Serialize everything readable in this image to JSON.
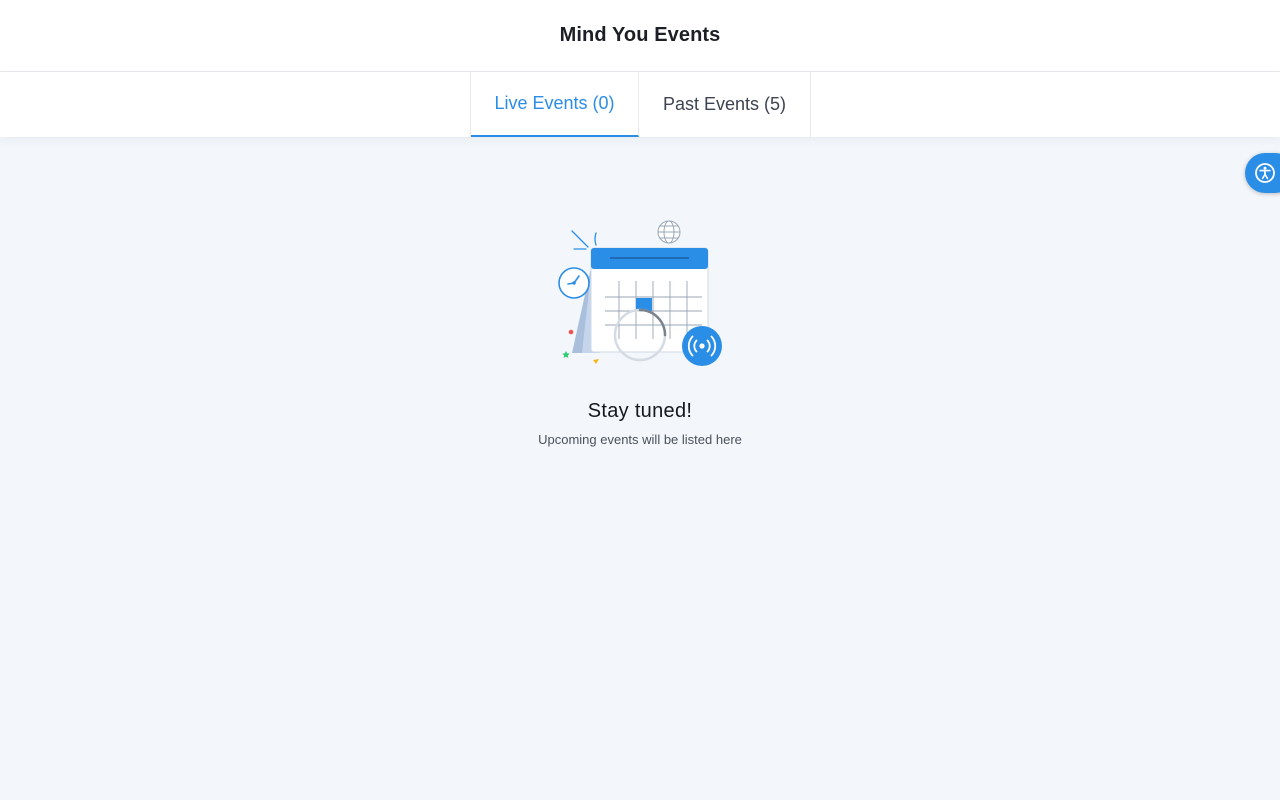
{
  "header": {
    "title": "Mind You Events"
  },
  "tabs": [
    {
      "label": "Live Events (0)",
      "active": true
    },
    {
      "label": "Past Events (5)",
      "active": false
    }
  ],
  "empty_state": {
    "title": "Stay tuned!",
    "subtitle": "Upcoming events will be listed here",
    "illustration": "calendar-live-illustration"
  },
  "accessibility_button": {
    "icon": "accessibility-icon"
  },
  "colors": {
    "accent": "#2b8ee6",
    "background": "#f3f7fb",
    "header_bg": "#ffffff",
    "text_primary": "#14171c",
    "text_secondary": "#4a505c"
  }
}
